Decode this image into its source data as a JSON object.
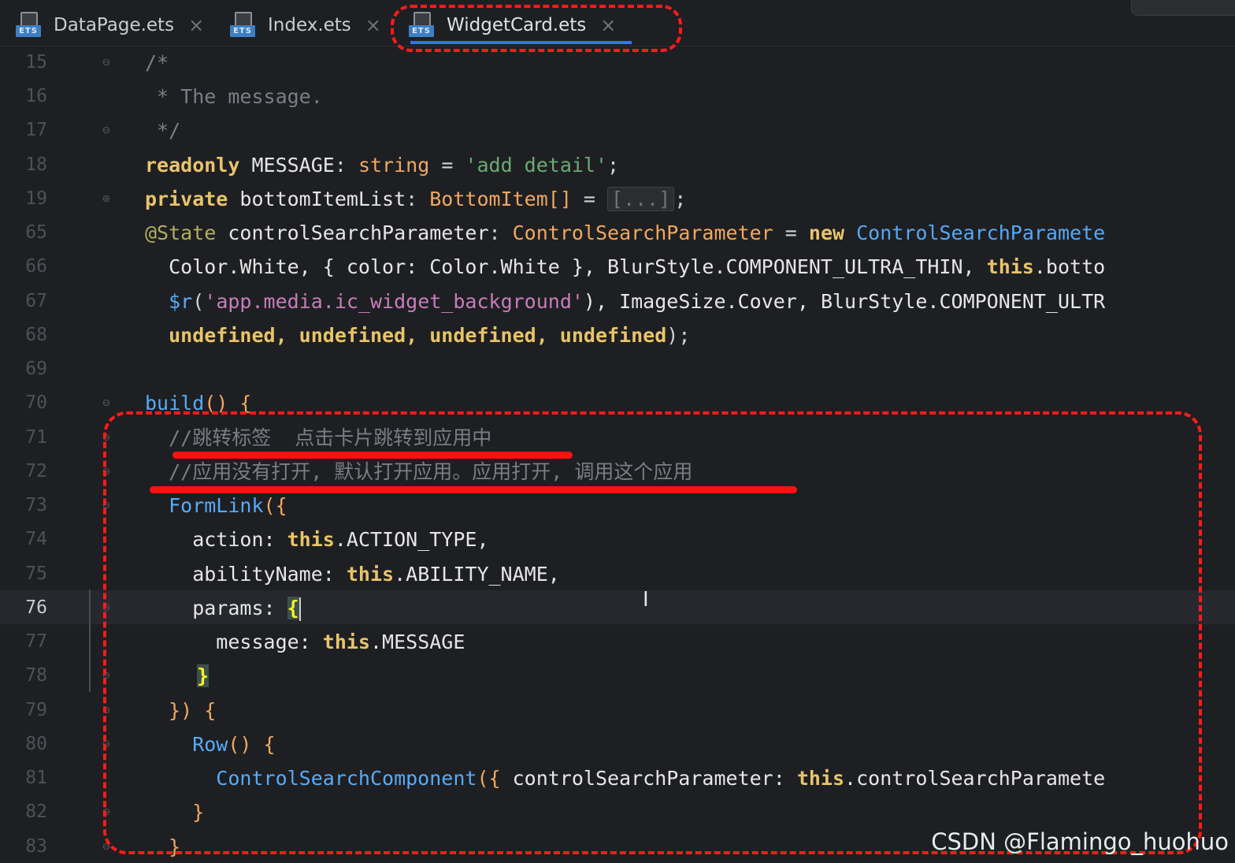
{
  "tabs": [
    {
      "label": "DataPage.ets",
      "icon": "ets-file-icon",
      "badge": "ETS",
      "active": false
    },
    {
      "label": "Index.ets",
      "icon": "ets-file-icon",
      "badge": "ETS",
      "active": false
    },
    {
      "label": "WidgetCard.ets",
      "icon": "ets-file-icon",
      "badge": "ETS",
      "active": true
    }
  ],
  "close_glyph": "×",
  "line_numbers": [
    "15",
    "16",
    "17",
    "18",
    "19",
    "65",
    "66",
    "67",
    "68",
    "69",
    "70",
    "71",
    "72",
    "73",
    "74",
    "75",
    "76",
    "77",
    "78",
    "79",
    "80",
    "81",
    "82",
    "83"
  ],
  "current_line": "76",
  "code": {
    "l15": "/*",
    "l16": " * The message.",
    "l17": " */",
    "l18_kw": "readonly",
    "l18_id": " MESSAGE",
    "l18_p1": ": ",
    "l18_type": "string",
    "l18_p2": " = ",
    "l18_str": "'add detail'",
    "l18_p3": ";",
    "l19_kw": "private",
    "l19_id": " bottomItemList",
    "l19_p1": ": ",
    "l19_type": "BottomItem[]",
    "l19_p2": " = ",
    "l19_fold": "[...]",
    "l19_p3": ";",
    "l65_ann": "@State",
    "l65_id": " controlSearchParameter",
    "l65_p1": ": ",
    "l65_type": "ControlSearchParameter",
    "l65_p2": " = ",
    "l65_kw": "new",
    "l65_cls": " ControlSearchParamete",
    "l66": "  Color.White, { color: Color.White }, BlurStyle.COMPONENT_ULTRA_THIN, ",
    "l66_kw": "this",
    "l66_tail": ".botto",
    "l67_fn": "  $r",
    "l67_p1": "(",
    "l67_str": "'app.media.ic_widget_background'",
    "l67_p2": "), ImageSize.Cover, BlurStyle.COMPONENT_ULTR",
    "l68": "  undefined, undefined, undefined, undefined",
    "l68_p": ");",
    "l70_fn": "build",
    "l70_p": "() {",
    "l71": "  //跳转标签  点击卡片跳转到应用中",
    "l72": "  //应用没有打开, 默认打开应用。应用打开, 调用这个应用",
    "l73_fn": "  FormLink",
    "l73_p": "({",
    "l74_id": "    action: ",
    "l74_kw": "this",
    "l74_tail": ".ACTION_TYPE,",
    "l75_id": "    abilityName: ",
    "l75_kw": "this",
    "l75_tail": ".ABILITY_NAME,",
    "l76_id": "    params: ",
    "l76_brace": "{",
    "l77_id": "      message: ",
    "l77_kw": "this",
    "l77_tail": ".MESSAGE",
    "l78_brace": "}",
    "l79": "  }) {",
    "l80_fn": "    Row",
    "l80_p": "() {",
    "l81_fn": "      ControlSearchComponent",
    "l81_p1": "({ ",
    "l81_id": "controlSearchParameter: ",
    "l81_kw": "this",
    "l81_tail": ".controlSearchParamete",
    "l82": "    }",
    "l83": "  }"
  },
  "watermark": "CSDN @Flamingo_huohuo",
  "colors": {
    "annotation": "#ff1a1a",
    "keyword": "#e8c46a",
    "type": "#f0a860",
    "string": "#6aab73",
    "comment": "#7a7e85",
    "function": "#57aaf7",
    "active_tab_underline": "#3574f0"
  }
}
